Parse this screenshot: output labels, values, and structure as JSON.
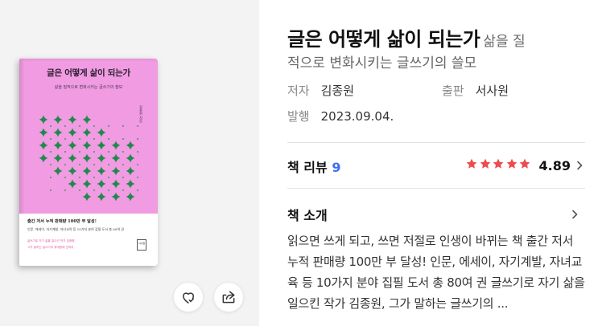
{
  "book": {
    "title": "글은 어떻게 삶이 되는가",
    "subtitle_part1": "삶을 질",
    "subtitle_part2": "적으로 변화시키는 글쓰기의 쓸모"
  },
  "cover": {
    "title": "글은 어떻게 삶이 되는가",
    "subtitle": "삶을 질적으로 변화시키는 글쓰기의 쓸모",
    "author": "김종원 지음",
    "band_line1": "출간 저서 누적 판매량 100만 부 달성!",
    "band_line2": "인문, 에세이, 자기계발, 자녀교육 등 10가지 분야 집필 도서 총 80여 권",
    "band_line3": "글쓰기로 자기 삶을 일으킨 작가 김종원,",
    "band_line4": "그가 말하는 글쓰기의 위대함에 관하여",
    "publisher_mark": "서사원",
    "background_color": "#f09be2",
    "pattern_color": "#1f8a4c"
  },
  "meta": {
    "author_label": "저자",
    "author_value": "김종원",
    "publisher_label": "출판",
    "publisher_value": "서사원",
    "date_label": "발행",
    "date_value": "2023.09.04."
  },
  "review": {
    "label": "책 리뷰",
    "count": "9",
    "rating": "4.89",
    "stars": 5,
    "star_color": "#ef4b4b",
    "count_color": "#3d6df2"
  },
  "intro": {
    "label": "책 소개",
    "text": "읽으면 쓰게 되고, 쓰면 저절로 인생이 바뀌는 책 출간 저서 누적 판매량 100만 부 달성! 인문, 에세이, 자기계발, 자녀교육 등 10가지 분야 집필 도서 총 80여 권 글쓰기로 자기 삶을 일으킨 작가 김종원, 그가 말하는 글쓰기의 ..."
  },
  "icons": {
    "like": "heart-check-icon",
    "share": "share-icon",
    "chevron": "chevron-right-icon",
    "star": "star-icon"
  }
}
